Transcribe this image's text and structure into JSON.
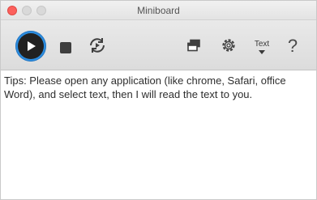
{
  "window": {
    "title": "Miniboard"
  },
  "toolbar": {
    "buttons": [
      {
        "name": "play",
        "icon": "play-icon"
      },
      {
        "name": "stop",
        "icon": "stop-icon"
      },
      {
        "name": "repeat",
        "icon": "repeat-icon"
      },
      {
        "name": "window",
        "icon": "window-icon"
      },
      {
        "name": "settings",
        "icon": "gear-icon"
      },
      {
        "name": "text",
        "icon": "text-dropdown-icon"
      },
      {
        "name": "help",
        "icon": "help-icon"
      }
    ],
    "text_label": "Text",
    "help_label": "?"
  },
  "content": {
    "tips": "Tips: Please open any application (like chrome, Safari, office Word), and select text, then I will read the text to you."
  },
  "colors": {
    "accent": "#2b8de1",
    "close": "#fc605c"
  }
}
